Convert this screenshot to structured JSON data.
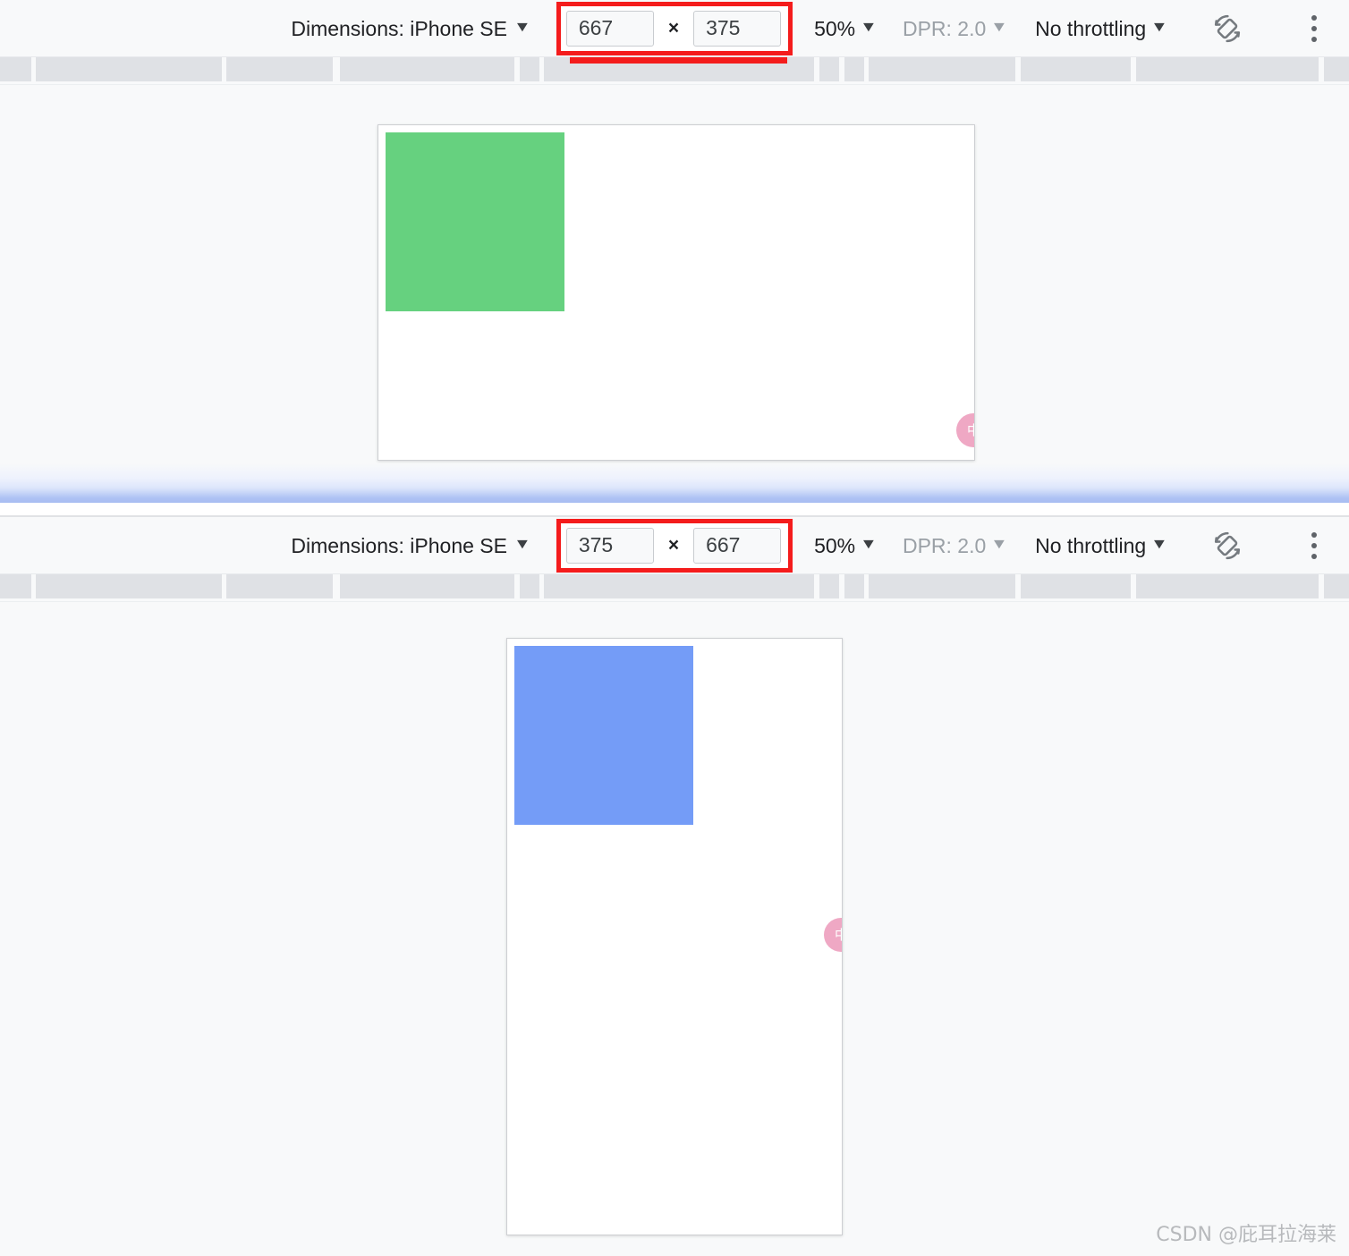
{
  "captures": [
    {
      "id": "landscape",
      "toolbar": {
        "dimensions_label": "Dimensions: iPhone SE",
        "width_value": "667",
        "height_value": "375",
        "multiply_symbol": "×",
        "zoom_label": "50%",
        "dpr_label": "DPR: 2.0",
        "throttling_label": "No throttling",
        "rotate_icon": "rotate-device-icon",
        "menu_icon": "kebab-menu-icon",
        "caret_icon": "chevron-down-icon"
      },
      "viewport": {
        "block_color": "#66d17f",
        "block_label": "green-color-block",
        "badge_text": "中",
        "badge_color": "#efa8c4"
      }
    },
    {
      "id": "portrait",
      "toolbar": {
        "dimensions_label": "Dimensions: iPhone SE",
        "width_value": "375",
        "height_value": "667",
        "multiply_symbol": "×",
        "zoom_label": "50%",
        "dpr_label": "DPR: 2.0",
        "throttling_label": "No throttling",
        "rotate_icon": "rotate-device-icon",
        "menu_icon": "kebab-menu-icon",
        "caret_icon": "chevron-down-icon"
      },
      "viewport": {
        "block_color": "#749cf7",
        "block_label": "blue-color-block",
        "badge_text": "中",
        "badge_color": "#efa8c4"
      }
    }
  ],
  "colors": {
    "highlight_border": "#f41c1c",
    "ruler_segment": "#dfe1e5",
    "toolbar_bg": "#f8f9fa",
    "stage_bg": "#f8f9fa",
    "divider_glow": "#a8bdf2"
  },
  "watermark": {
    "text": "CSDN @庇耳拉海莱"
  }
}
